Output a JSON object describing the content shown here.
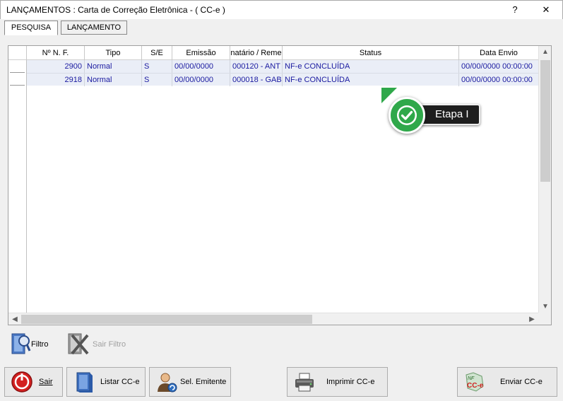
{
  "window": {
    "title": "LANÇAMENTOS : Carta de Correção Eletrônica - ( CC-e )",
    "help_label": "?",
    "close_label": "✕"
  },
  "tabs": [
    {
      "label": "PESQUISA",
      "active": true
    },
    {
      "label": "LANÇAMENTO",
      "active": false
    }
  ],
  "grid": {
    "columns": [
      "Nº N. F.",
      "Tipo",
      "S/E",
      "Emissão",
      "natário / Reme",
      "Status",
      "Data Envio"
    ],
    "rows": [
      {
        "nf": "2900",
        "tipo": "Normal",
        "se": "S",
        "emissao": "00/00/0000",
        "dest": "000120 - ANT",
        "status": "NF-e CONCLUÍDA",
        "envio": "00/00/0000 00:00:00"
      },
      {
        "nf": "2918",
        "tipo": "Normal",
        "se": "S",
        "emissao": "00/00/0000",
        "dest": "000018 - GAB",
        "status": "NF-e CONCLUÍDA",
        "envio": "00/00/0000 00:00:00"
      }
    ]
  },
  "callout": {
    "label": "Etapa I",
    "color": "#2fa84a"
  },
  "filters": {
    "filtro_label": "Filtro",
    "sair_filtro_label": "Sair Filtro"
  },
  "buttons": {
    "sair": "Sair",
    "listar": "Listar CC-e",
    "emitente": "Sel. Emitente",
    "imprimir": "Imprimir CC-e",
    "enviar": "Enviar CC-e"
  },
  "icons": {
    "help": "help-icon",
    "close": "close-icon",
    "check": "check-icon",
    "filter": "filter-icon",
    "clear_filter": "clear-filter-icon",
    "exit": "exit-icon",
    "list": "list-icon",
    "user": "user-icon",
    "printer": "printer-icon",
    "send": "send-cce-icon"
  }
}
